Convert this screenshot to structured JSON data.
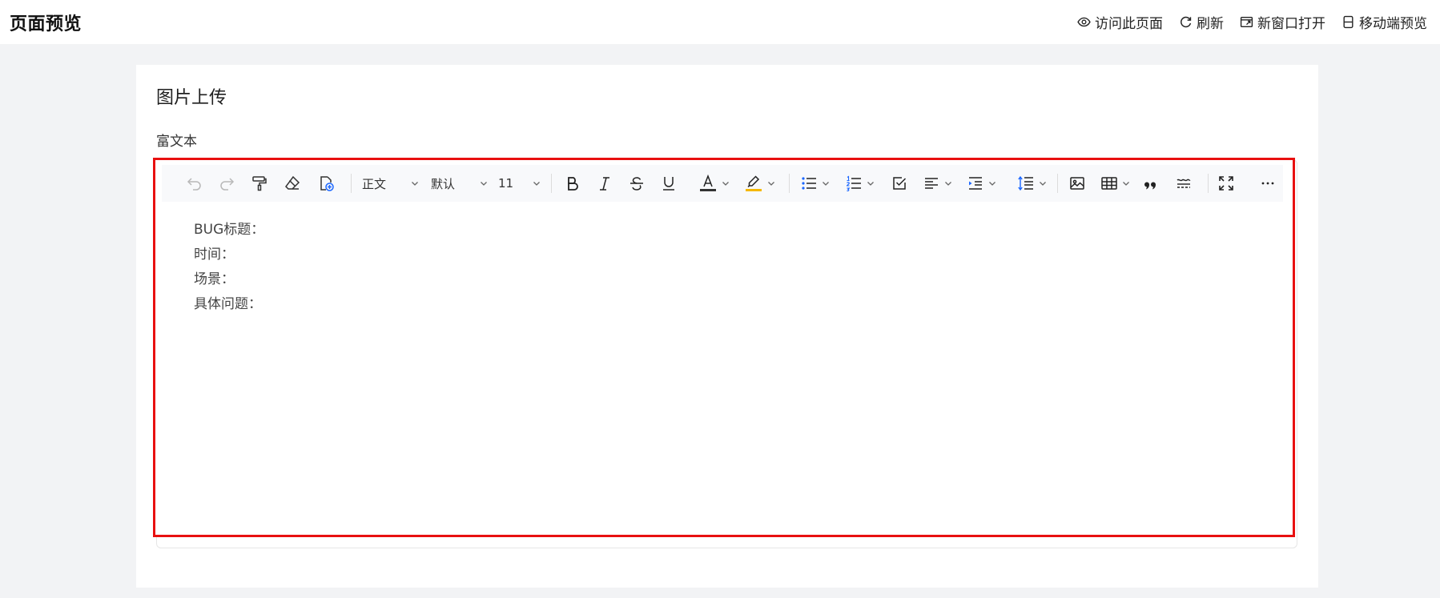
{
  "header": {
    "title": "页面预览",
    "actions": [
      {
        "label": "访问此页面",
        "icon": "eye-icon"
      },
      {
        "label": "刷新",
        "icon": "refresh-icon"
      },
      {
        "label": "新窗口打开",
        "icon": "new-window-icon"
      },
      {
        "label": "移动端预览",
        "icon": "mobile-icon"
      }
    ]
  },
  "card": {
    "title": "图片上传",
    "field_label": "富文本"
  },
  "toolbar": {
    "paragraph_style": "正文",
    "font_family": "默认",
    "font_size": "11",
    "font_color": "#333333",
    "highlight_color": "#f5b800"
  },
  "editor": {
    "lines": [
      "BUG标题：",
      "时间：",
      "场景：",
      "具体问题："
    ]
  },
  "colors": {
    "highlight_border": "#e81010",
    "page_background": "#f2f3f5"
  }
}
